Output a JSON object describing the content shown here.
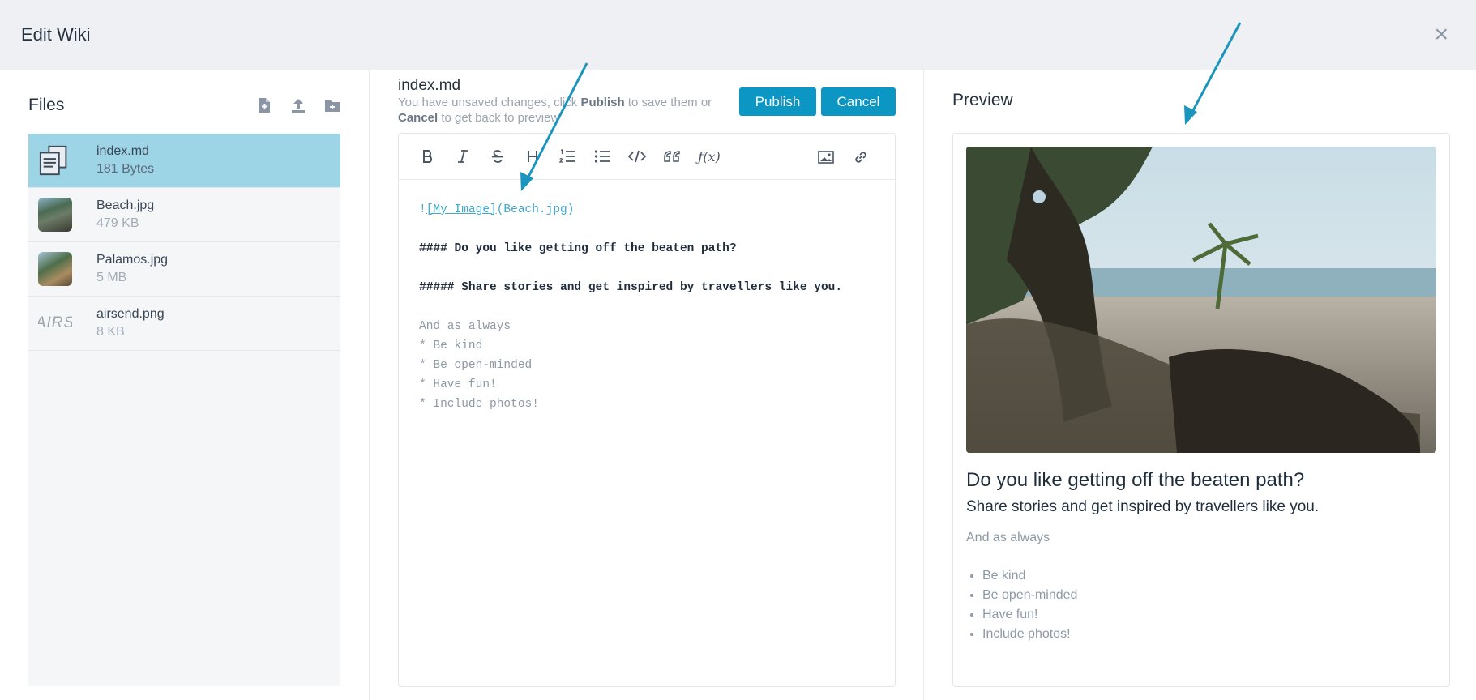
{
  "header": {
    "title": "Edit Wiki",
    "close_icon": "×"
  },
  "files": {
    "title": "Files",
    "actions": [
      "new-file-icon",
      "upload-icon",
      "new-folder-icon"
    ],
    "items": [
      {
        "name": "index.md",
        "size": "181 Bytes",
        "thumb": "document-icon",
        "active": true
      },
      {
        "name": "Beach.jpg",
        "size": "479 KB",
        "thumb": "beach-thumbnail"
      },
      {
        "name": "Palamos.jpg",
        "size": "5 MB",
        "thumb": "palamos-thumbnail"
      },
      {
        "name": "airsend.png",
        "size": "8 KB",
        "thumb": "AIRS"
      }
    ]
  },
  "editor": {
    "filename": "index.md",
    "notice_1": "You have unsaved changes, click ",
    "notice_publish": "Publish",
    "notice_2": " to save them or ",
    "notice_cancel": "Cancel",
    "notice_3": " to get back to preview",
    "publish_label": "Publish",
    "cancel_label": "Cancel",
    "toolbar": [
      "bold-icon",
      "italic-icon",
      "strikethrough-icon",
      "heading-icon",
      "ordered-list-icon",
      "unordered-list-icon",
      "code-icon",
      "quote-icon",
      "formula-icon",
      "image-icon",
      "link-icon"
    ],
    "lines": {
      "img_prefix": "!",
      "img_alt": "[My Image]",
      "img_src": "(Beach.jpg)",
      "h4": "#### Do you like getting off the beaten path?",
      "h5": "##### Share stories and get inspired by travellers like you.",
      "p": "And as always",
      "li1": "* Be kind",
      "li2": "* Be open-minded",
      "li3": "* Have fun!",
      "li4": "* Include photos!"
    }
  },
  "preview": {
    "title": "Preview",
    "heading": "Do you like getting off the beaten path?",
    "subheading": "Share stories and get inspired by travellers like you.",
    "paragraph": "And as always",
    "list": [
      "Be kind",
      "Be open-minded",
      "Have fun!",
      "Include photos!"
    ]
  },
  "colors": {
    "accent": "#0b96c4",
    "active_row": "#9dd4e6",
    "header_bg": "#eef0f3",
    "arrow": "#1a95be"
  }
}
